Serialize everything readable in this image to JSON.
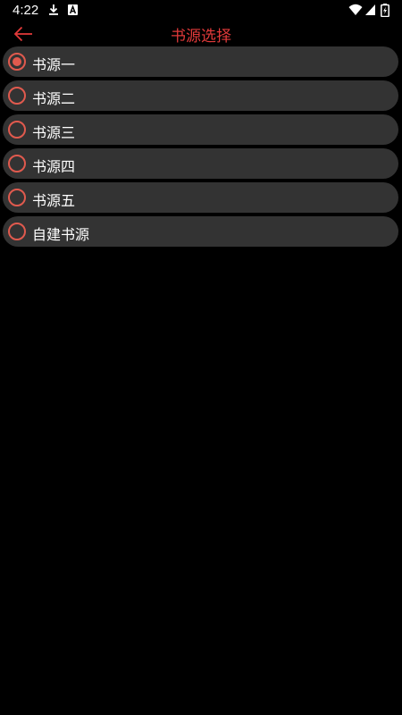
{
  "status_bar": {
    "time": "4:22",
    "icons": [
      "download-icon",
      "a-box-icon",
      "wifi-icon",
      "signal-icon",
      "battery-charging-icon"
    ]
  },
  "header": {
    "title": "书源选择",
    "back_icon": "arrow-left-icon"
  },
  "colors": {
    "accent": "#e23a3a",
    "radio": "#e05a4e",
    "item_background": "#333333",
    "background": "#000000"
  },
  "options": [
    {
      "label": "书源一",
      "selected": true
    },
    {
      "label": "书源二",
      "selected": false
    },
    {
      "label": "书源三",
      "selected": false
    },
    {
      "label": "书源四",
      "selected": false
    },
    {
      "label": "书源五",
      "selected": false
    },
    {
      "label": "自建书源",
      "selected": false
    }
  ]
}
